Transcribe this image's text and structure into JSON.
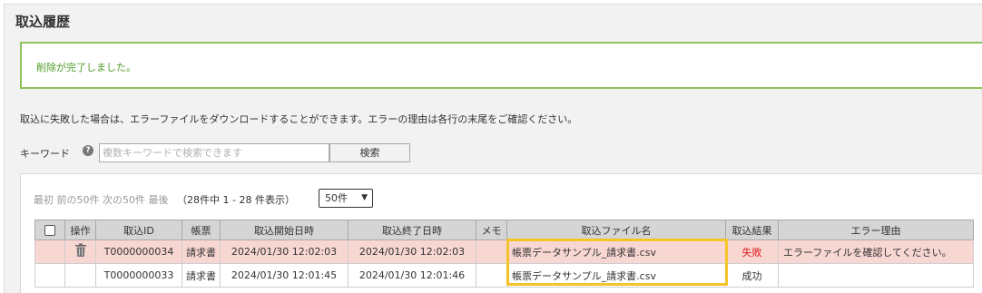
{
  "page": {
    "title": "取込履歴"
  },
  "alert": {
    "message": "削除が完了しました。",
    "color": "#4f9a2a"
  },
  "info_text": "取込に失敗した場合は、エラーファイルをダウンロードすることができます。エラーの理由は各行の末尾をご確認ください。",
  "search": {
    "label": "キーワード",
    "help_icon": "question-circle-icon",
    "placeholder": "複数キーワードで検索できます",
    "value": "",
    "button_label": "検索"
  },
  "pager": {
    "first": "最初",
    "prev": "前の50件",
    "next": "次の50件",
    "last": "最後",
    "summary": "（28件中 1 - 28 件表示）",
    "page_size": "50件"
  },
  "table": {
    "headers": {
      "select": "",
      "action": "操作",
      "id": "取込ID",
      "form": "帳票",
      "start": "取込開始日時",
      "end": "取込終了日時",
      "memo": "メモ",
      "file": "取込ファイル名",
      "result": "取込結果",
      "error": "エラー理由"
    },
    "rows": [
      {
        "id": "T0000000034",
        "form": "請求書",
        "start": "2024/01/30 12:02:03",
        "end": "2024/01/30 12:02:03",
        "memo": "",
        "file": "帳票データサンプル_請求書.csv",
        "result": "失敗",
        "error": "エラーファイルを確認してください。",
        "status": "fail",
        "action_icon": "trash-icon"
      },
      {
        "id": "T0000000033",
        "form": "請求書",
        "start": "2024/01/30 12:01:45",
        "end": "2024/01/30 12:01:46",
        "memo": "",
        "file": "帳票データサンプル_請求書.csv",
        "result": "成功",
        "error": "",
        "status": "ok",
        "action_icon": ""
      }
    ]
  },
  "colors": {
    "fail_row": "#f8d7d2",
    "fail_text": "#e02020",
    "highlight": "#f5c428",
    "header_bg": "#d5d5d5"
  }
}
